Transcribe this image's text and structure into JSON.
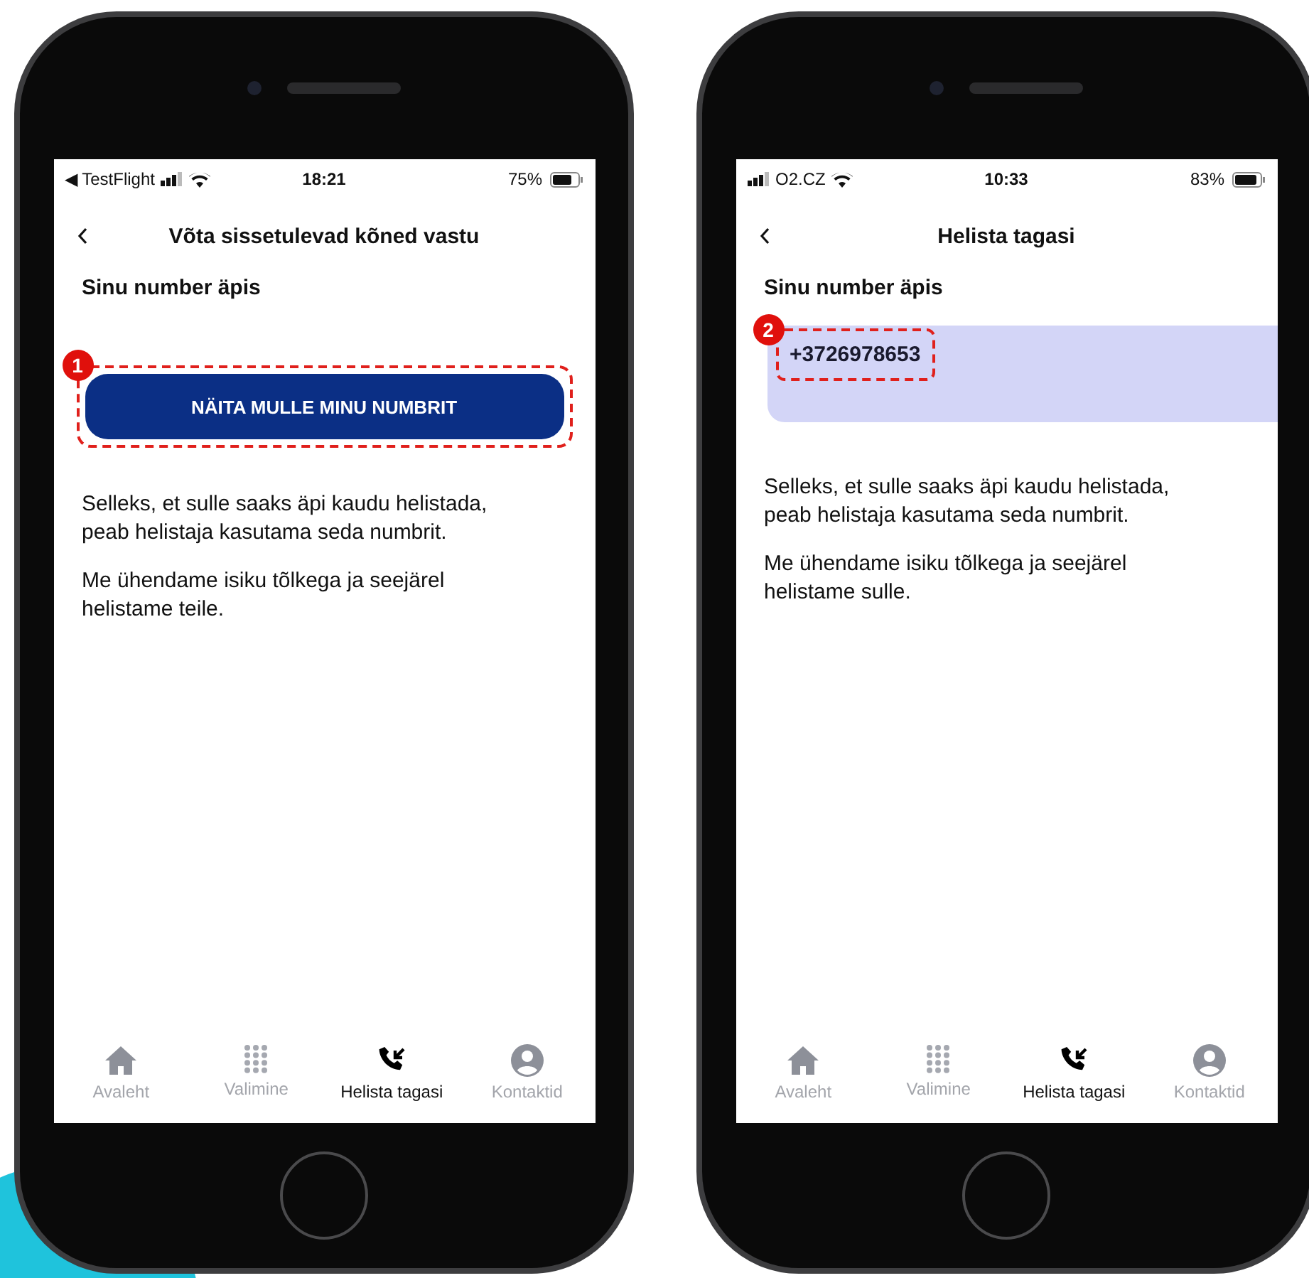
{
  "phones": [
    {
      "annotation": {
        "number": "1"
      },
      "status_bar": {
        "carrier": "◀ TestFlight",
        "time": "18:21",
        "battery": "75%"
      },
      "header": {
        "title": "Võta sissetulevad kõned vastu"
      },
      "section_label": "Sinu number äpis",
      "number_block": {
        "kind": "button",
        "text": "NÄITA MULLE MINU NUMBRIT"
      },
      "paragraphs": [
        "Selleks, et sulle saaks äpi kaudu helistada, peab helistaja kasutama seda numbrit.",
        "Me ühendame isiku tõlkega ja seejärel helistame teile."
      ],
      "tabs": [
        {
          "label": "Avaleht",
          "kind": "home",
          "selected": false
        },
        {
          "label": "Valimine",
          "kind": "dialpad",
          "selected": false
        },
        {
          "label": "Helista tagasi",
          "kind": "callback",
          "selected": true
        },
        {
          "label": "Kontaktid",
          "kind": "contacts",
          "selected": false
        }
      ]
    },
    {
      "annotation": {
        "number": "2"
      },
      "status_bar": {
        "carrier": "O2.CZ",
        "time": "10:33",
        "battery": "83%"
      },
      "header": {
        "title": "Helista tagasi"
      },
      "section_label": "Sinu number äpis",
      "number_block": {
        "kind": "number",
        "text": "+3726978653"
      },
      "paragraphs": [
        "Selleks, et sulle saaks äpi kaudu helistada, peab helistaja kasutama seda numbrit.",
        "Me ühendame isiku tõlkega ja seejärel helistame sulle."
      ],
      "tabs": [
        {
          "label": "Avaleht",
          "kind": "home",
          "selected": false
        },
        {
          "label": "Valimine",
          "kind": "dialpad",
          "selected": false
        },
        {
          "label": "Helista tagasi",
          "kind": "callback",
          "selected": true
        },
        {
          "label": "Kontaktid",
          "kind": "contacts",
          "selected": false
        }
      ]
    }
  ]
}
